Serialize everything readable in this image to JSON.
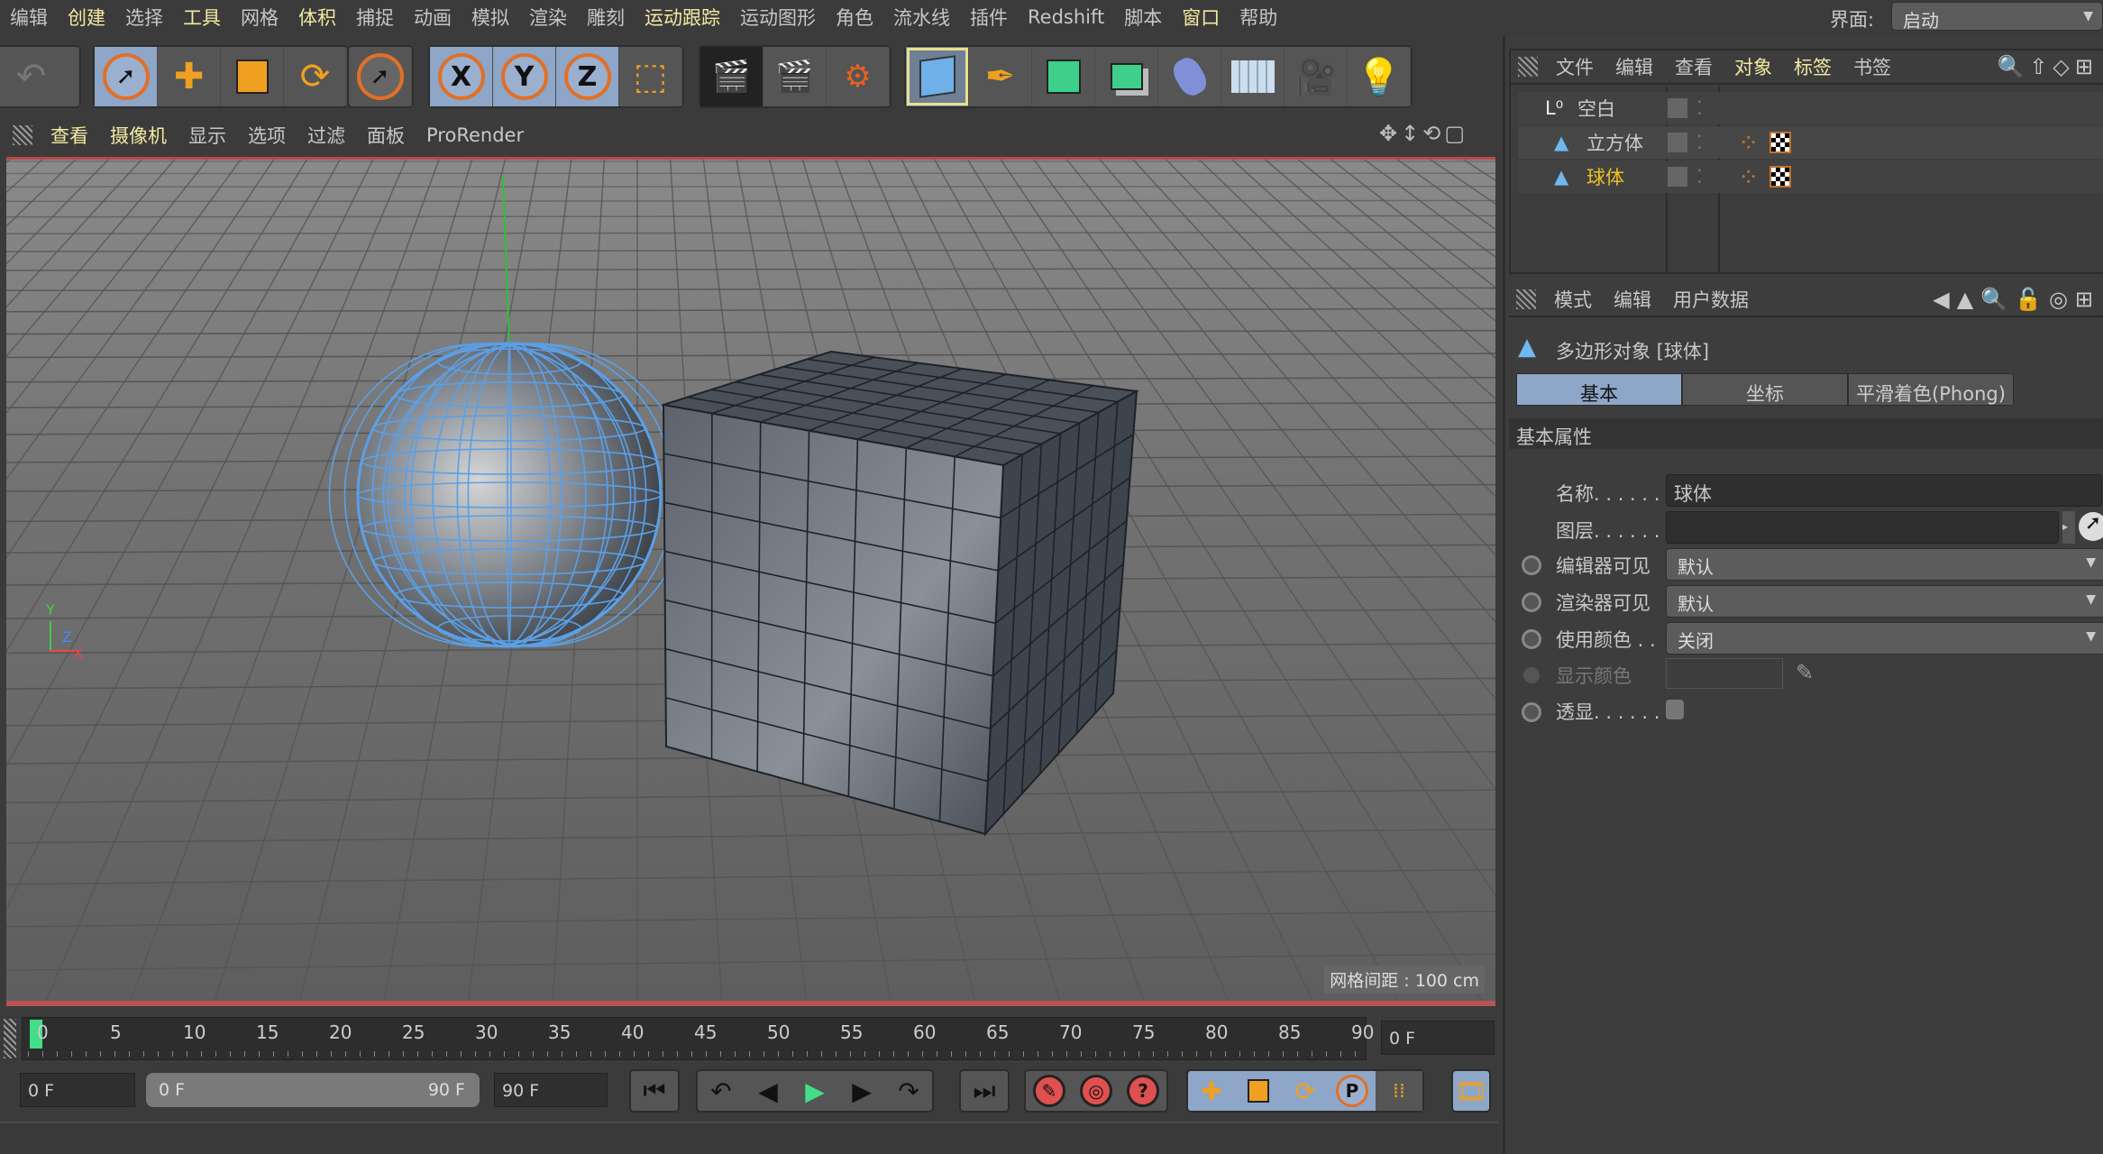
{
  "menubar": [
    "编辑",
    "创建",
    "选择",
    "工具",
    "网格",
    "体积",
    "捕捉",
    "动画",
    "模拟",
    "渲染",
    "雕刻",
    "运动跟踪",
    "运动图形",
    "角色",
    "流水线",
    "插件",
    "Redshift",
    "脚本",
    "窗口",
    "帮助"
  ],
  "menubar_highlight": [
    1,
    3,
    5,
    11,
    18
  ],
  "layout": {
    "label": "界面:",
    "value": "启动"
  },
  "toolbar": {
    "axis": [
      "X",
      "Y",
      "Z"
    ],
    "icons": [
      "undo-icon",
      "select-icon",
      "move-icon",
      "scale-icon",
      "rotate-icon",
      "live-select-icon",
      "x-axis-icon",
      "y-axis-icon",
      "z-axis-icon",
      "coordinate-system-icon",
      "render-view-icon",
      "render-to-picture-viewer-icon",
      "render-settings-icon",
      "cube-icon",
      "pen-icon",
      "subdivision-icon",
      "array-icon",
      "deformer-icon",
      "floor-icon",
      "camera-icon",
      "light-icon"
    ]
  },
  "viewport": {
    "menus": [
      "查看",
      "摄像机",
      "显示",
      "选项",
      "过滤",
      "面板",
      "ProRender"
    ],
    "menus_highlight": [
      0,
      1
    ],
    "grid_spacing": "网格间距 : 100 cm",
    "axis_labels": [
      "Y",
      "Z",
      "X"
    ]
  },
  "object_manager": {
    "menus": [
      "文件",
      "编辑",
      "查看",
      "对象",
      "标签",
      "书签"
    ],
    "menus_highlight": [
      3,
      4
    ],
    "objects": [
      {
        "name": "空白",
        "type": "null",
        "selected": false
      },
      {
        "name": "立方体",
        "type": "polygon",
        "selected": false
      },
      {
        "name": "球体",
        "type": "polygon",
        "selected": true
      }
    ]
  },
  "attributes": {
    "menus": [
      "模式",
      "编辑",
      "用户数据"
    ],
    "title": "多边形对象 [球体]",
    "tabs": [
      "基本",
      "坐标",
      "平滑着色(Phong)"
    ],
    "active_tab": 0,
    "section": "基本属性",
    "fields": {
      "name_label": "名称. . . . . .",
      "name_value": "球体",
      "layer_label": "图层. . . . . .",
      "editor_vis_label": "编辑器可见",
      "editor_vis_value": "默认",
      "render_vis_label": "渲染器可见",
      "render_vis_value": "默认",
      "use_color_label": "使用颜色 . .",
      "use_color_value": "关闭",
      "display_color_label": "显示颜色",
      "xray_label": "透显. . . . . ."
    }
  },
  "timeline": {
    "ticks": [
      0,
      5,
      10,
      15,
      20,
      25,
      30,
      35,
      40,
      45,
      50,
      55,
      60,
      65,
      70,
      75,
      80,
      85,
      90
    ],
    "current_frame": 0,
    "current_field": "0 F",
    "start": "0 F",
    "range_start": "0 F",
    "range_end": "90 F",
    "end": "90 F"
  },
  "colors": {
    "accent_blue": "#8ea6c8",
    "highlight_text": "#f2e9a0",
    "selected_object": "#f0c020",
    "timeline_marker": "#44dd88"
  }
}
